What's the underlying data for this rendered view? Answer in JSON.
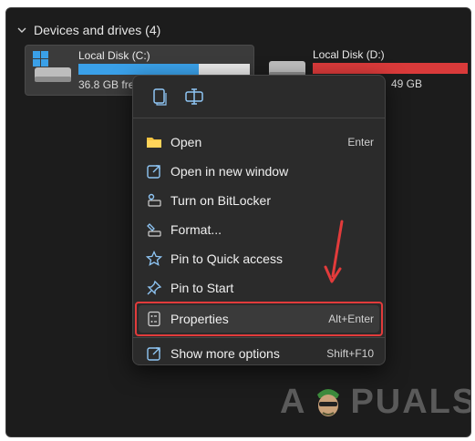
{
  "section": {
    "title": "Devices and drives (4)"
  },
  "drives": [
    {
      "name": "Local Disk (C:)",
      "free_text": "36.8 GB free",
      "used_fraction": 0.7,
      "bar_color": "#3aa0e8"
    },
    {
      "name": "Local Disk (D:)",
      "free_text": "49 GB",
      "used_fraction": 1.0,
      "bar_color": "#d93a3a"
    }
  ],
  "menu": {
    "top_icons": [
      "copy-icon",
      "rename-icon"
    ],
    "items": [
      {
        "icon": "folder-icon",
        "label": "Open",
        "shortcut": "Enter"
      },
      {
        "icon": "open-new-window-icon",
        "label": "Open in new window",
        "shortcut": ""
      },
      {
        "icon": "bitlocker-key-icon",
        "label": "Turn on BitLocker",
        "shortcut": ""
      },
      {
        "icon": "format-drive-icon",
        "label": "Format...",
        "shortcut": ""
      },
      {
        "icon": "star-icon",
        "label": "Pin to Quick access",
        "shortcut": ""
      },
      {
        "icon": "pin-icon",
        "label": "Pin to Start",
        "shortcut": ""
      },
      {
        "icon": "properties-icon",
        "label": "Properties",
        "shortcut": "Alt+Enter"
      },
      {
        "icon": "show-more-icon",
        "label": "Show more options",
        "shortcut": "Shift+F10"
      }
    ]
  },
  "watermark": {
    "text_left": "A",
    "text_right": "PUALS"
  },
  "colors": {
    "highlight": "#e23b3b",
    "accent": "#3aa0e8"
  }
}
